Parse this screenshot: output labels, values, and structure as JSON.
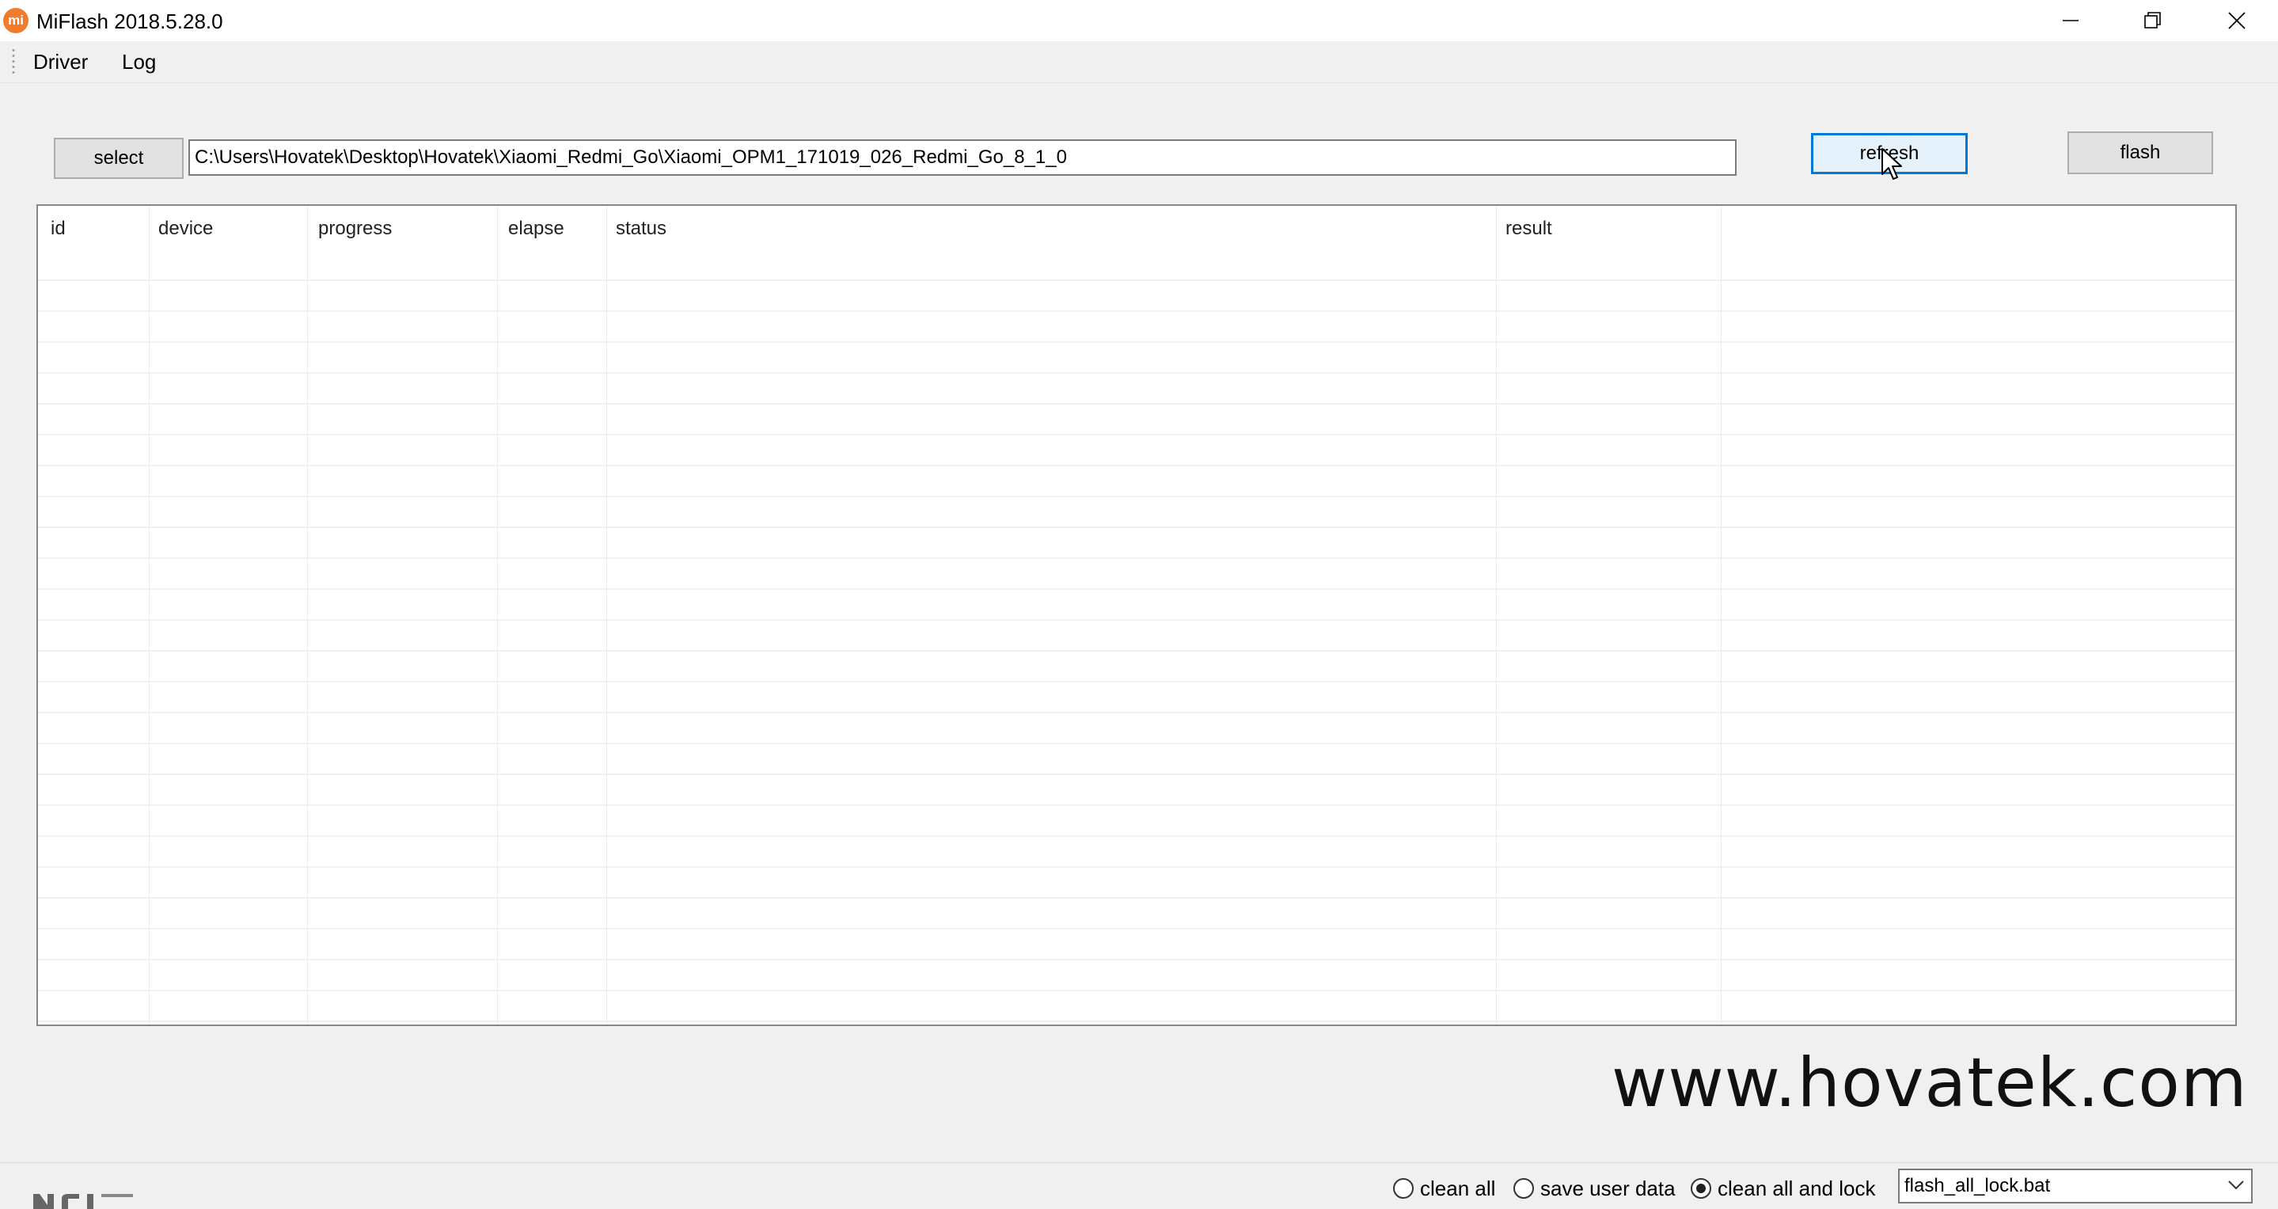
{
  "window": {
    "title": "MiFlash 2018.5.28.0",
    "app_icon_text": "mi",
    "accent_color": "#f27a2a"
  },
  "menu": {
    "items": [
      {
        "label": "Driver"
      },
      {
        "label": "Log"
      }
    ]
  },
  "toolbar": {
    "select_label": "select",
    "path_value": "C:\\Users\\Hovatek\\Desktop\\Hovatek\\Xiaomi_Redmi_Go\\Xiaomi_OPM1_171019_026_Redmi_Go_8_1_0",
    "refresh_label": "refresh",
    "flash_label": "flash"
  },
  "table": {
    "columns": [
      "id",
      "device",
      "progress",
      "elapse",
      "status",
      "result"
    ],
    "rows": []
  },
  "watermark": "www.hovatek.com",
  "options": {
    "radios": [
      {
        "label": "clean all",
        "checked": false
      },
      {
        "label": "save user data",
        "checked": false
      },
      {
        "label": "clean all and lock",
        "checked": true
      }
    ],
    "script_selected": "flash_all_lock.bat"
  }
}
